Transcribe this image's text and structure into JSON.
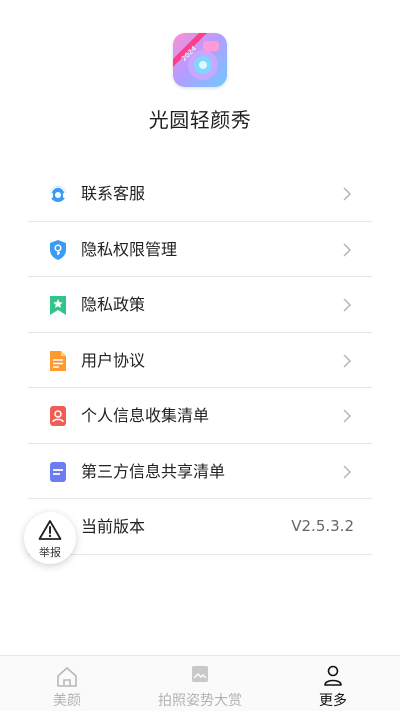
{
  "app": {
    "name": "光圆轻颜秀",
    "logo_badge": "2024",
    "logo_icon": "camera-app-logo"
  },
  "menu": {
    "items": [
      {
        "label": "联系客服",
        "icon": "customer-service-icon",
        "color": "#3b9cf5"
      },
      {
        "label": "隐私权限管理",
        "icon": "shield-key-icon",
        "color": "#3b9cf5"
      },
      {
        "label": "隐私政策",
        "icon": "bookmark-star-icon",
        "color": "#33c48d"
      },
      {
        "label": "用户协议",
        "icon": "document-icon",
        "color": "#ff9a2e"
      },
      {
        "label": "个人信息收集清单",
        "icon": "person-card-icon",
        "color": "#f25c54"
      },
      {
        "label": "第三方信息共享清单",
        "icon": "list-document-icon",
        "color": "#6c7df0"
      },
      {
        "label": "当前版本",
        "value": "V2.5.3.2"
      }
    ]
  },
  "report_button": {
    "label": "举报",
    "icon": "warning-triangle-icon"
  },
  "tabbar": {
    "tabs": [
      {
        "label": "美颜",
        "icon": "home-icon",
        "active": false
      },
      {
        "label": "拍照姿势大赏",
        "icon": "image-icon",
        "active": false
      },
      {
        "label": "更多",
        "icon": "person-icon",
        "active": true
      }
    ]
  }
}
